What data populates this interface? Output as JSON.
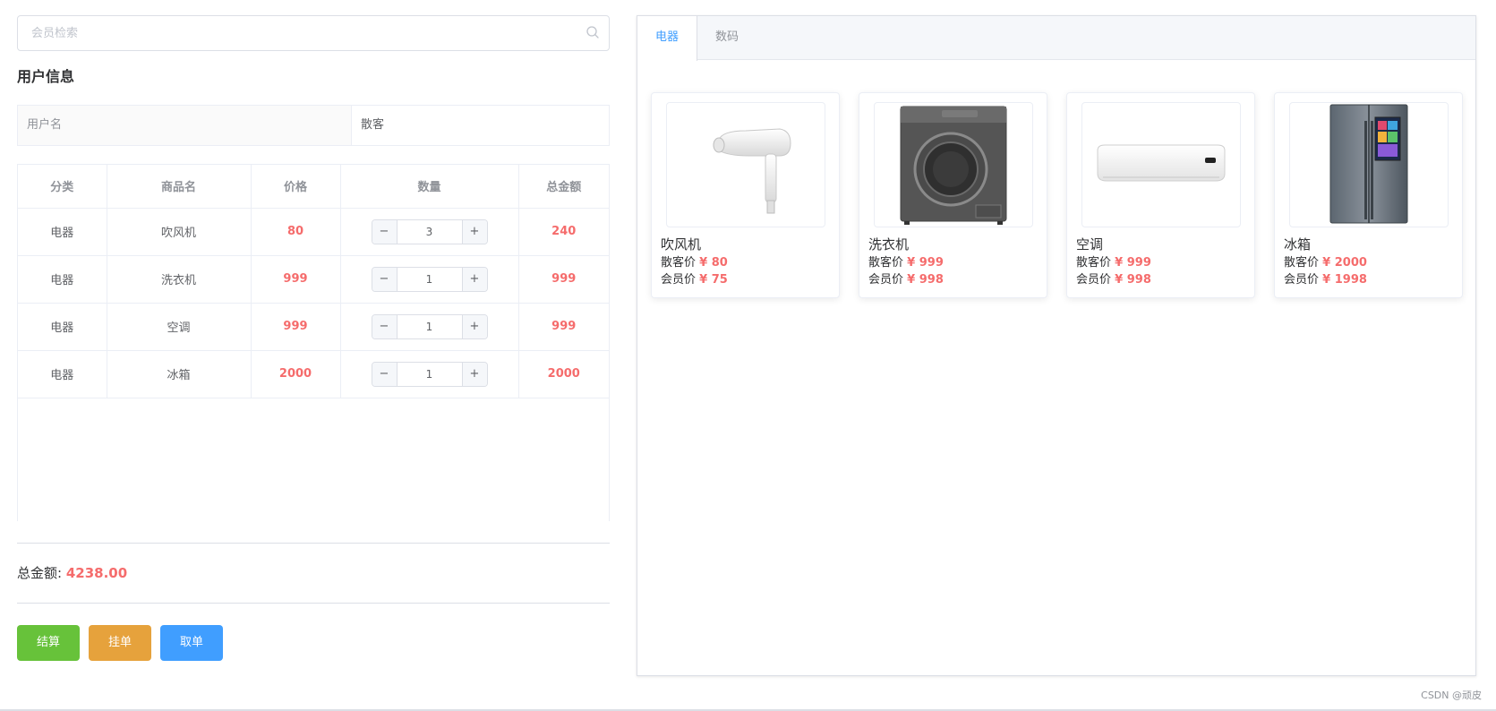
{
  "search": {
    "placeholder": "会员检索"
  },
  "user_section": {
    "title": "用户信息",
    "label": "用户名",
    "value": "散客"
  },
  "table": {
    "headers": [
      "分类",
      "商品名",
      "价格",
      "数量",
      "总金额"
    ],
    "rows": [
      {
        "category": "电器",
        "name": "吹风机",
        "price": "80",
        "qty": "3",
        "total": "240"
      },
      {
        "category": "电器",
        "name": "洗衣机",
        "price": "999",
        "qty": "1",
        "total": "999"
      },
      {
        "category": "电器",
        "name": "空调",
        "price": "999",
        "qty": "1",
        "total": "999"
      },
      {
        "category": "电器",
        "name": "冰箱",
        "price": "2000",
        "qty": "1",
        "total": "2000"
      }
    ]
  },
  "summary": {
    "label": "总金额:",
    "amount": "4238.00"
  },
  "actions": {
    "checkout": "结算",
    "hold": "挂单",
    "retrieve": "取单"
  },
  "tabs": [
    {
      "label": "电器",
      "active": true
    },
    {
      "label": "数码",
      "active": false
    }
  ],
  "products": [
    {
      "name": "吹风机",
      "guest_label": "散客价",
      "guest_price": "¥ 80",
      "member_label": "会员价",
      "member_price": "¥ 75",
      "icon": "hair-dryer-image"
    },
    {
      "name": "洗衣机",
      "guest_label": "散客价",
      "guest_price": "¥ 999",
      "member_label": "会员价",
      "member_price": "¥ 998",
      "icon": "washing-machine-image"
    },
    {
      "name": "空调",
      "guest_label": "散客价",
      "guest_price": "¥ 999",
      "member_label": "会员价",
      "member_price": "¥ 998",
      "icon": "air-conditioner-image"
    },
    {
      "name": "冰箱",
      "guest_label": "散客价",
      "guest_price": "¥ 2000",
      "member_label": "会员价",
      "member_price": "¥ 1998",
      "icon": "refrigerator-image"
    }
  ],
  "watermark": "CSDN @顽皮",
  "colors": {
    "accent": "#409eff",
    "price_red": "#f56c6c",
    "green": "#67c23a",
    "orange": "#e6a23c"
  }
}
